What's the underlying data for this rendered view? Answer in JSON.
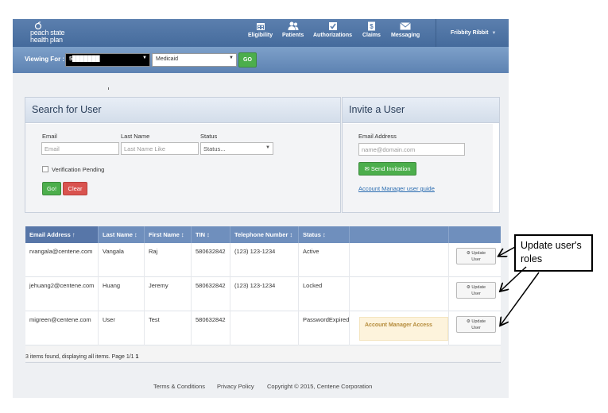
{
  "header": {
    "logo_line1": "peach state",
    "logo_line2": "health plan",
    "nav": [
      {
        "label": "Eligibility",
        "icon": "calendar-icon"
      },
      {
        "label": "Patients",
        "icon": "patients-icon"
      },
      {
        "label": "Authorizations",
        "icon": "checkbox-icon"
      },
      {
        "label": "Claims",
        "icon": "dollar-document-icon"
      },
      {
        "label": "Messaging",
        "icon": "envelope-icon"
      }
    ],
    "user_name": "Fribbity Ribbit"
  },
  "viewing_for": {
    "label": "Viewing For :",
    "provider_value": "5███████",
    "plan_value": "Medicaid",
    "go_label": "GO"
  },
  "search": {
    "title": "Search for User",
    "email_label": "Email",
    "email_placeholder": "Email",
    "last_name_label": "Last Name",
    "last_name_placeholder": "Last Name Like",
    "status_label": "Status",
    "status_value": "Status...",
    "verification_label": "Verification Pending",
    "go_label": "Go!",
    "clear_label": "Clear"
  },
  "invite": {
    "title": "Invite a User",
    "email_label": "Email Address",
    "email_placeholder": "name@domain.com",
    "send_label": "Send Invitation",
    "guide_link": "Account Manager user guide"
  },
  "table": {
    "columns": [
      "Email Address ↑",
      "Last Name ↕",
      "First Name ↕",
      "TIN ↕",
      "Telephone Number ↕",
      "Status ↕"
    ],
    "rows": [
      {
        "email": "rvangala@centene.com",
        "last": "Vangala",
        "first": "Raj",
        "tin": "580632842",
        "phone": "(123) 123-1234",
        "status": "Active",
        "note": ""
      },
      {
        "email": "jehuang2@centene.com",
        "last": "Huang",
        "first": "Jeremy",
        "tin": "580632842",
        "phone": "(123) 123-1234",
        "status": "Locked",
        "note": ""
      },
      {
        "email": "migreen@centene.com",
        "last": "User",
        "first": "Test",
        "tin": "580632842",
        "phone": "",
        "status": "PasswordExpired",
        "note": "Account Manager Access"
      }
    ],
    "update_line1": "Update",
    "update_line2": "User",
    "footer_text": "3 items found, displaying all items. Page 1/1",
    "footer_page": "1"
  },
  "footer": {
    "terms": "Terms & Conditions",
    "privacy": "Privacy Policy",
    "copyright": "Copyright © 2015, Centene Corporation"
  },
  "annotation": {
    "line1": "Update user's",
    "line2": "roles"
  },
  "colors": {
    "header_blue": "#456b9c",
    "table_header": "#6f8fbd",
    "go_green": "#4cae4c",
    "clear_red": "#d9534f",
    "link_blue": "#2a6cb0"
  }
}
